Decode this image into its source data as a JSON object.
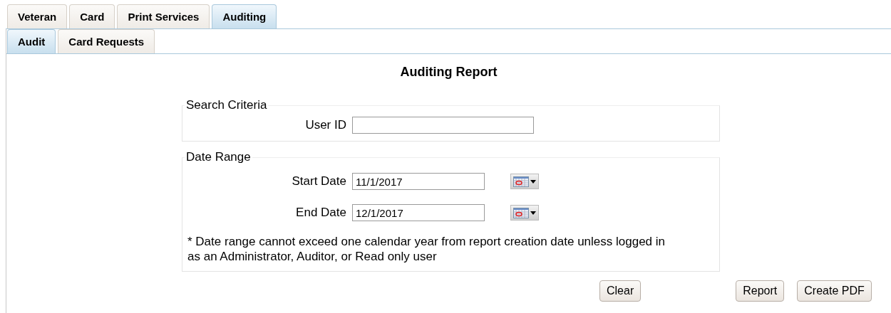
{
  "tabs": [
    {
      "label": "Veteran",
      "selected": false
    },
    {
      "label": "Card",
      "selected": false
    },
    {
      "label": "Print Services",
      "selected": false
    },
    {
      "label": "Auditing",
      "selected": true
    }
  ],
  "subtabs": [
    {
      "label": "Audit",
      "selected": true
    },
    {
      "label": "Card Requests",
      "selected": false
    }
  ],
  "title": "Auditing Report",
  "search_criteria": {
    "legend": "Search Criteria",
    "fields": [
      {
        "label": "User ID"
      }
    ]
  },
  "date_range": {
    "legend": "Date Range",
    "fields": [
      {
        "label": "Start Date",
        "value": "11/1/2017"
      },
      {
        "label": "End Date",
        "value": "12/1/2017"
      }
    ],
    "note": "* Date range cannot exceed one calendar year from report creation date unless logged in as an Administrator, Auditor, or Read only user"
  },
  "buttons": [
    {
      "label": "Clear"
    },
    {
      "label": "Report"
    },
    {
      "label": "Create PDF"
    }
  ]
}
